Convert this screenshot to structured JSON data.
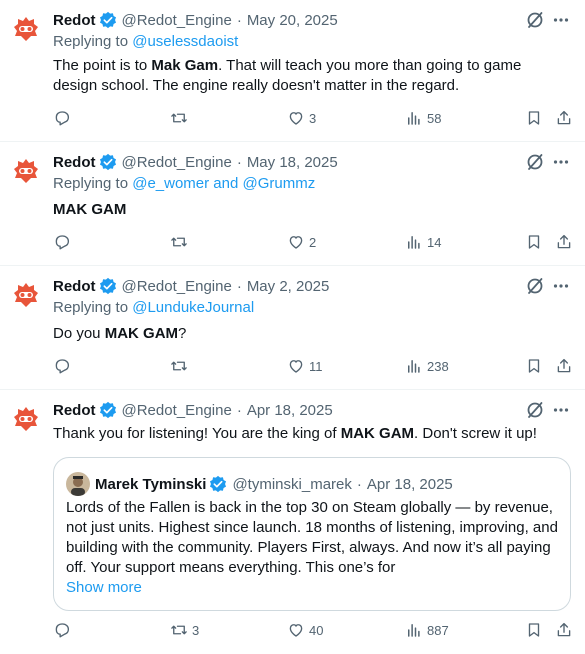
{
  "tweets": [
    {
      "name": "Redot",
      "handle": "@Redot_Engine",
      "date": "May 20, 2025",
      "reply_prefix": "Replying to",
      "reply_links": "@uselessdaoist",
      "text_pre": "The point is to ",
      "text_bold": "Mak Gam",
      "text_post": ". That will teach you more than going to game design school. The engine really doesn't matter in the regard.",
      "replies": "",
      "reposts": "",
      "likes": "3",
      "views": "58"
    },
    {
      "name": "Redot",
      "handle": "@Redot_Engine",
      "date": "May 18, 2025",
      "reply_prefix": "Replying to",
      "reply_links": "@e_womer and @Grummz",
      "text_pre": "",
      "text_bold": "MAK GAM",
      "text_post": "",
      "replies": "",
      "reposts": "",
      "likes": "2",
      "views": "14"
    },
    {
      "name": "Redot",
      "handle": "@Redot_Engine",
      "date": "May 2, 2025",
      "reply_prefix": "Replying to",
      "reply_links": "@LundukeJournal",
      "text_pre": "Do you ",
      "text_bold": "MAK GAM",
      "text_post": "?",
      "replies": "",
      "reposts": "",
      "likes": "11",
      "views": "238"
    },
    {
      "name": "Redot",
      "handle": "@Redot_Engine",
      "date": "Apr 18, 2025",
      "text_pre": "Thank you for listening! You are the king of ",
      "text_bold": "MAK GAM",
      "text_post": ". Don't screw it up!",
      "replies": "",
      "reposts": "3",
      "likes": "40",
      "views": "887",
      "quote": {
        "name": "Marek Tyminski",
        "handle": "@tyminski_marek",
        "date": "Apr 18, 2025",
        "text": "Lords of the Fallen is back in the top 30 on Steam globally — by revenue, not just units. Highest since launch. 18 months of listening, improving, and building with the community. Players First, always. And now it’s all paying off. Your support means everything. This one’s for",
        "show_more": "Show more"
      }
    }
  ],
  "separator": "·",
  "colors": {
    "accent": "#1d9bf0",
    "muted": "#536471",
    "text": "#0f1419",
    "logo": "#e8553a",
    "border": "#eff3f4"
  },
  "icons": {
    "verified": "verified-badge-icon",
    "grok": "grok-icon",
    "more": "more-horizontal-icon",
    "reply": "reply-icon",
    "repost": "repost-icon",
    "like": "heart-icon",
    "views": "views-chart-icon",
    "bookmark": "bookmark-icon",
    "share": "share-icon"
  }
}
